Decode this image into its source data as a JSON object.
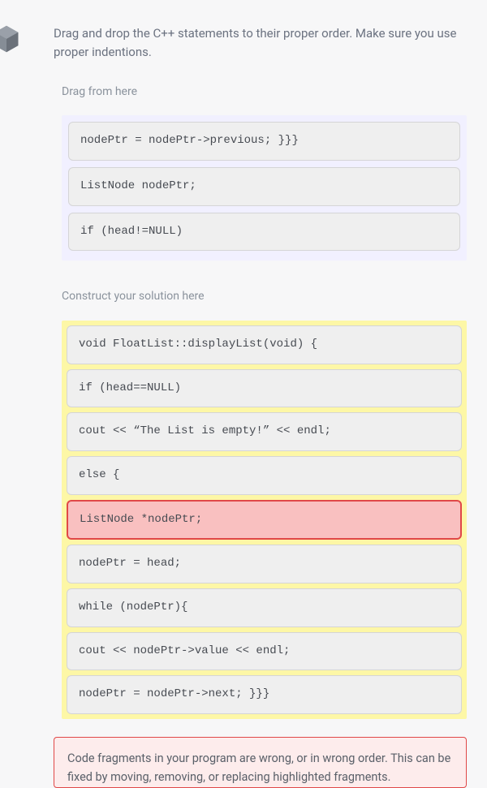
{
  "instructions": "Drag and drop the C++ statements to their proper order. Make sure you use proper indentions.",
  "drag_label": "Drag from here",
  "source_blocks": [
    {
      "code": "nodePtr = nodePtr->previous; }}}"
    },
    {
      "code": "ListNode nodePtr;"
    },
    {
      "code": "if (head!=NULL)"
    }
  ],
  "solution_label": "Construct your solution here",
  "solution_blocks": [
    {
      "code": "void FloatList::displayList(void) {",
      "error": false
    },
    {
      "code": "if (head==NULL)",
      "error": false
    },
    {
      "code": "cout << “The List is empty!” << endl;",
      "error": false
    },
    {
      "code": "else {",
      "error": false
    },
    {
      "code": "ListNode *nodePtr;",
      "error": true
    },
    {
      "code": "nodePtr = head;",
      "error": false
    },
    {
      "code": "while (nodePtr){",
      "error": false
    },
    {
      "code": "cout << nodePtr->value << endl;",
      "error": false
    },
    {
      "code": "nodePtr = nodePtr->next; }}}",
      "error": false
    }
  ],
  "feedback": "Code fragments in your program are wrong, or in wrong order. This can be fixed by moving, removing, or replacing highlighted fragments."
}
